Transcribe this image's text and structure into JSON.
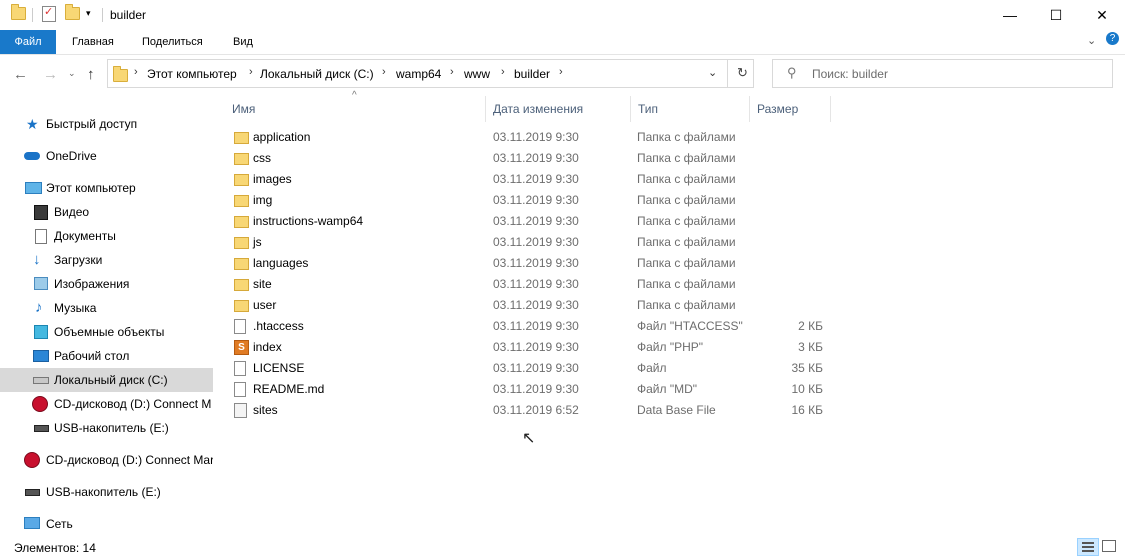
{
  "window": {
    "title": "builder",
    "minimize": "—",
    "maximize": "☐",
    "close": "✕"
  },
  "ribbon": {
    "tabs": [
      "Файл",
      "Главная",
      "Поделиться",
      "Вид"
    ],
    "expand_icon": "chevron-down-icon",
    "help": "?"
  },
  "address": {
    "crumbs": [
      "Этот компьютер",
      "Локальный диск (C:)",
      "wamp64",
      "www",
      "builder"
    ],
    "search_placeholder": "Поиск: builder"
  },
  "sidebar": {
    "items": [
      {
        "label": "Быстрый доступ",
        "icon": "star-icon"
      },
      {
        "label": "OneDrive",
        "icon": "cloud-icon"
      },
      {
        "label": "Этот компьютер",
        "icon": "computer-icon"
      },
      {
        "label": "Видео",
        "icon": "video-icon"
      },
      {
        "label": "Документы",
        "icon": "document-icon"
      },
      {
        "label": "Загрузки",
        "icon": "download-icon"
      },
      {
        "label": "Изображения",
        "icon": "image-icon"
      },
      {
        "label": "Музыка",
        "icon": "music-icon"
      },
      {
        "label": "Объемные объекты",
        "icon": "cube-icon"
      },
      {
        "label": "Рабочий стол",
        "icon": "desktop-icon"
      },
      {
        "label": "Локальный диск (C:)",
        "icon": "drive-icon"
      },
      {
        "label": "CD-дисковод (D:) Connect M",
        "icon": "cd-icon"
      },
      {
        "label": "USB-накопитель (E:)",
        "icon": "usb-icon"
      },
      {
        "label": "CD-дисковод (D:) Connect Mar",
        "icon": "cd-icon"
      },
      {
        "label": "USB-накопитель (E:)",
        "icon": "usb-icon"
      },
      {
        "label": "Сеть",
        "icon": "network-icon"
      }
    ]
  },
  "columns": {
    "name": "Имя",
    "date": "Дата изменения",
    "type": "Тип",
    "size": "Размер"
  },
  "files": [
    {
      "name": "application",
      "date": "03.11.2019 9:30",
      "type": "Папка с файлами",
      "size": "",
      "icon": "folder"
    },
    {
      "name": "css",
      "date": "03.11.2019 9:30",
      "type": "Папка с файлами",
      "size": "",
      "icon": "folder"
    },
    {
      "name": "images",
      "date": "03.11.2019 9:30",
      "type": "Папка с файлами",
      "size": "",
      "icon": "folder"
    },
    {
      "name": "img",
      "date": "03.11.2019 9:30",
      "type": "Папка с файлами",
      "size": "",
      "icon": "folder"
    },
    {
      "name": "instructions-wamp64",
      "date": "03.11.2019 9:30",
      "type": "Папка с файлами",
      "size": "",
      "icon": "folder"
    },
    {
      "name": "js",
      "date": "03.11.2019 9:30",
      "type": "Папка с файлами",
      "size": "",
      "icon": "folder"
    },
    {
      "name": "languages",
      "date": "03.11.2019 9:30",
      "type": "Папка с файлами",
      "size": "",
      "icon": "folder"
    },
    {
      "name": "site",
      "date": "03.11.2019 9:30",
      "type": "Папка с файлами",
      "size": "",
      "icon": "folder"
    },
    {
      "name": "user",
      "date": "03.11.2019 9:30",
      "type": "Папка с файлами",
      "size": "",
      "icon": "folder"
    },
    {
      "name": ".htaccess",
      "date": "03.11.2019 9:30",
      "type": "Файл \"HTACCESS\"",
      "size": "2 КБ",
      "icon": "file"
    },
    {
      "name": "index",
      "date": "03.11.2019 9:30",
      "type": "Файл \"PHP\"",
      "size": "3 КБ",
      "icon": "php"
    },
    {
      "name": "LICENSE",
      "date": "03.11.2019 9:30",
      "type": "Файл",
      "size": "35 КБ",
      "icon": "file"
    },
    {
      "name": "README.md",
      "date": "03.11.2019 9:30",
      "type": "Файл \"MD\"",
      "size": "10 КБ",
      "icon": "file"
    },
    {
      "name": "sites",
      "date": "03.11.2019 6:52",
      "type": "Data Base File",
      "size": "16 КБ",
      "icon": "db"
    }
  ],
  "status": {
    "count_text": "Элементов: 14"
  }
}
